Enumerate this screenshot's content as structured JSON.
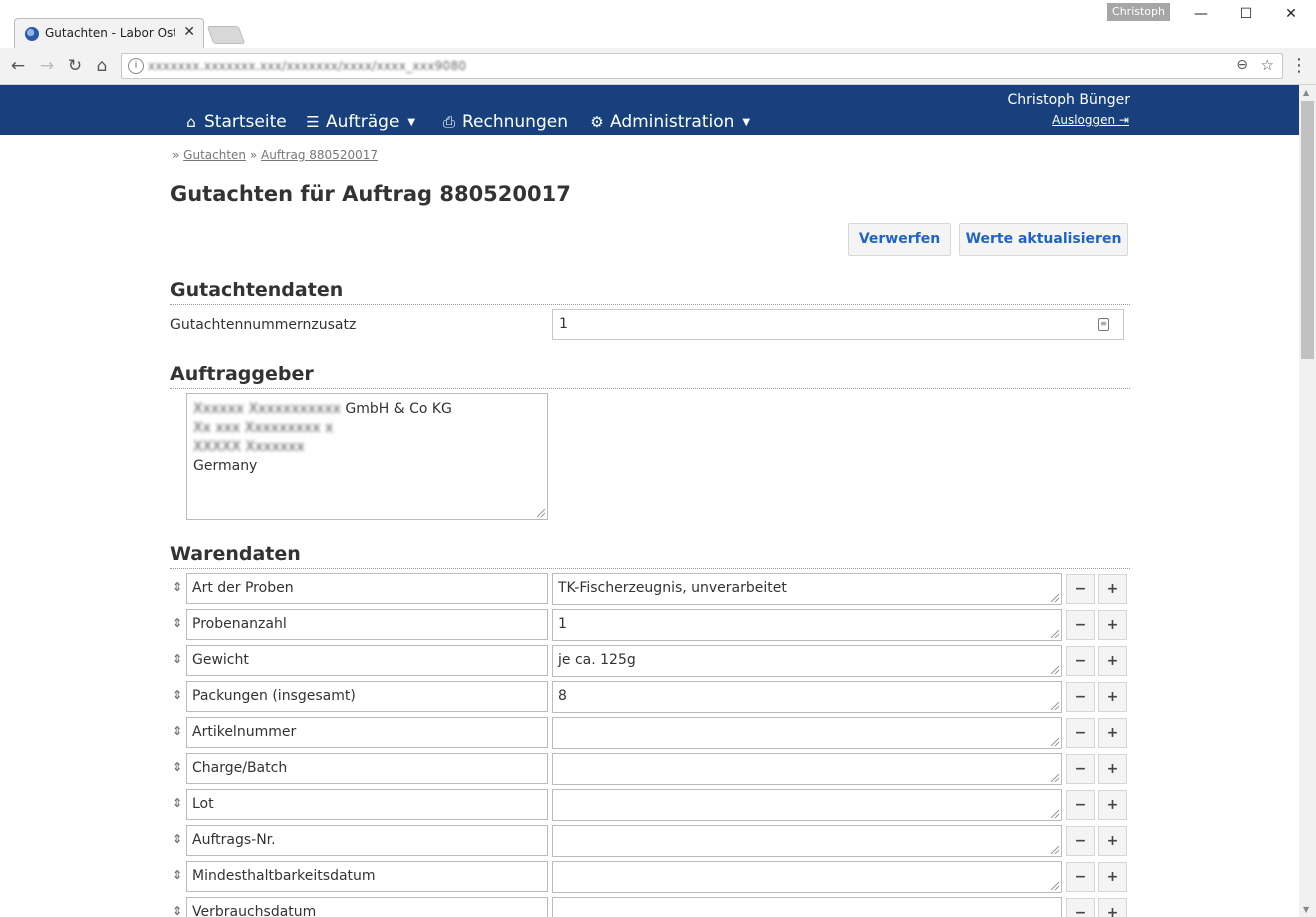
{
  "browser": {
    "tab_title": "Gutachten - Labor Osterl",
    "tab_close": "✕",
    "profile": "Christoph",
    "url": "xxxxxxx.xxxxxxx.xxx/xxxxxxx/xxxx/xxxx_xxx9080"
  },
  "nav": {
    "items": [
      {
        "label": "Startseite",
        "icon": "⌂"
      },
      {
        "label": "Aufträge",
        "icon": "☰",
        "caret": "▼"
      },
      {
        "label": "Rechnungen",
        "icon": "⎙"
      },
      {
        "label": "Administration",
        "icon": "⚙",
        "caret": "▼"
      }
    ],
    "user_name": "Christoph Bünger",
    "logout_label": "Ausloggen ⇥"
  },
  "breadcrumb": {
    "sep": "»",
    "items": [
      "Gutachten",
      "Auftrag 880520017"
    ]
  },
  "page_title": "Gutachten für Auftrag 880520017",
  "actions": {
    "discard": "Verwerfen",
    "update": "Werte aktualisieren"
  },
  "gutachtendaten": {
    "heading": "Gutachtendaten",
    "field_label": "Gutachtennummernzusatz",
    "field_value": "1"
  },
  "auftraggeber": {
    "heading": "Auftraggeber",
    "lines": [
      {
        "blurred": "Xxxxxx Xxxxxxxxxxx",
        "text": " GmbH & Co KG"
      },
      {
        "blurred": "Xx xxx Xxxxxxxxx x",
        "text": ""
      },
      {
        "blurred": "XXXXX Xxxxxxx",
        "text": ""
      },
      {
        "blurred": "",
        "text": "Germany"
      }
    ]
  },
  "warendaten": {
    "heading": "Warendaten",
    "minus": "−",
    "plus": "+",
    "handle": "⇕",
    "rows": [
      {
        "label": "Art der Proben",
        "value": "TK-Fischerzeugnis, unverarbeitet"
      },
      {
        "label": "Probenanzahl",
        "value": "1"
      },
      {
        "label": "Gewicht",
        "value": "je ca. 125g"
      },
      {
        "label": "Packungen (insgesamt)",
        "value": "8"
      },
      {
        "label": "Artikelnummer",
        "value": ""
      },
      {
        "label": "Charge/Batch",
        "value": ""
      },
      {
        "label": "Lot",
        "value": ""
      },
      {
        "label": "Auftrags-Nr.",
        "value": ""
      },
      {
        "label": "Mindesthaltbarkeitsdatum",
        "value": ""
      },
      {
        "label": "Verbrauchsdatum",
        "value": ""
      }
    ]
  },
  "colors": {
    "nav_bg": "#17407d",
    "link_blue": "#1f64c4"
  }
}
